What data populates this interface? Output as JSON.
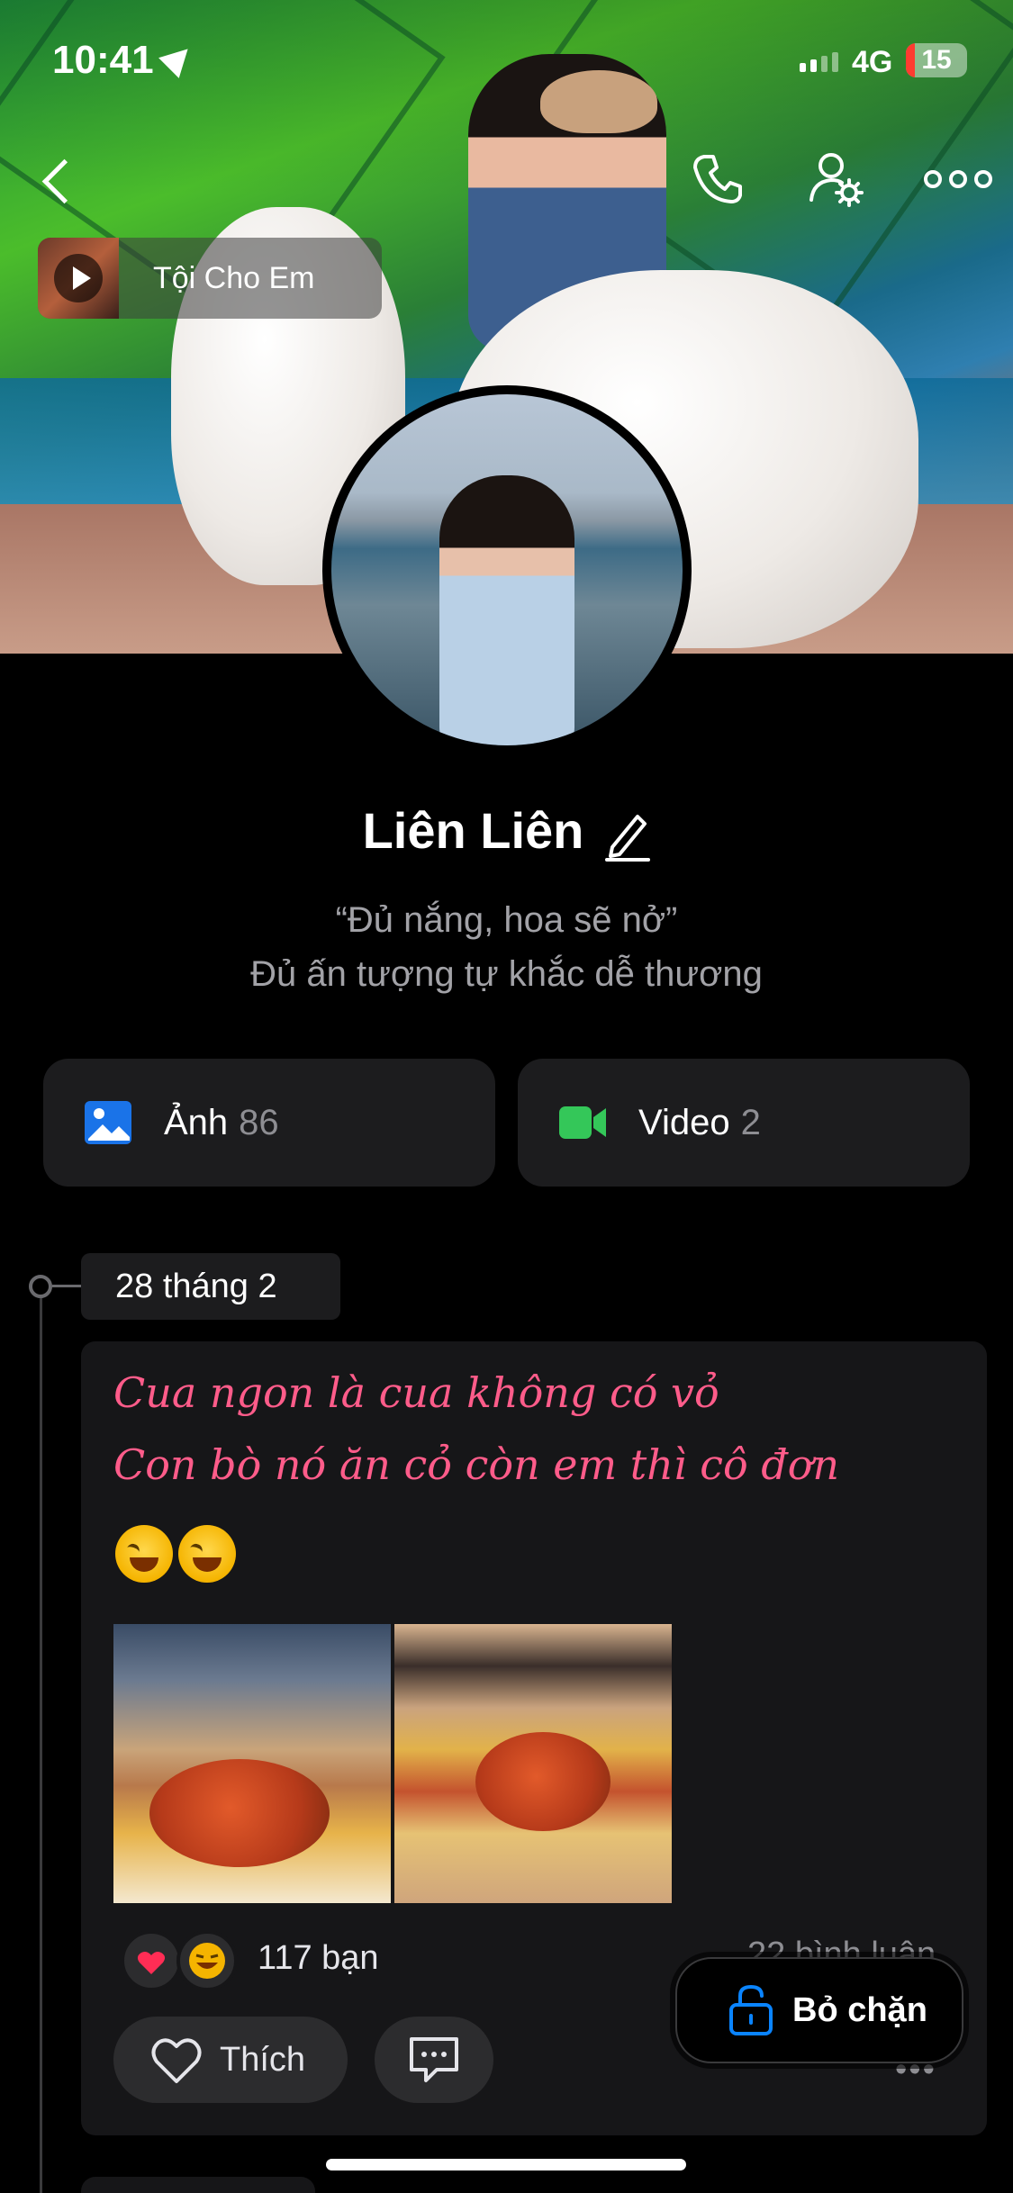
{
  "status_bar": {
    "time": "10:41",
    "network": "4G",
    "battery_level": "15",
    "battery_fraction": 0.15
  },
  "cover": {
    "music": {
      "title": "Tội Cho Em"
    }
  },
  "profile": {
    "name": "Liên Liên",
    "bio_line1": "“Đủ nắng, hoa sẽ nở”",
    "bio_line2": "Đủ ấn tượng tự khắc dễ thương"
  },
  "media": {
    "photos_label": "Ảnh",
    "photos_count": "86",
    "videos_label": "Video",
    "videos_count": "2"
  },
  "timeline": {
    "date": "28 tháng 2"
  },
  "post": {
    "line1": "Cua ngon là cua không có vỏ",
    "line2": "Con bò nó ăn cỏ còn em thì cô đơn",
    "reactions_count": "117 bạn",
    "comments_count": "22 bình luận",
    "like_label": "Thích"
  },
  "unblock": {
    "label": "Bỏ chặn"
  },
  "colors": {
    "accent_pink": "#ff5c8a",
    "photo_icon_blue": "#1a73e8",
    "video_icon_green": "#34c759",
    "unblock_icon_blue": "#0a84ff",
    "battery_low": "#ff3b30"
  }
}
